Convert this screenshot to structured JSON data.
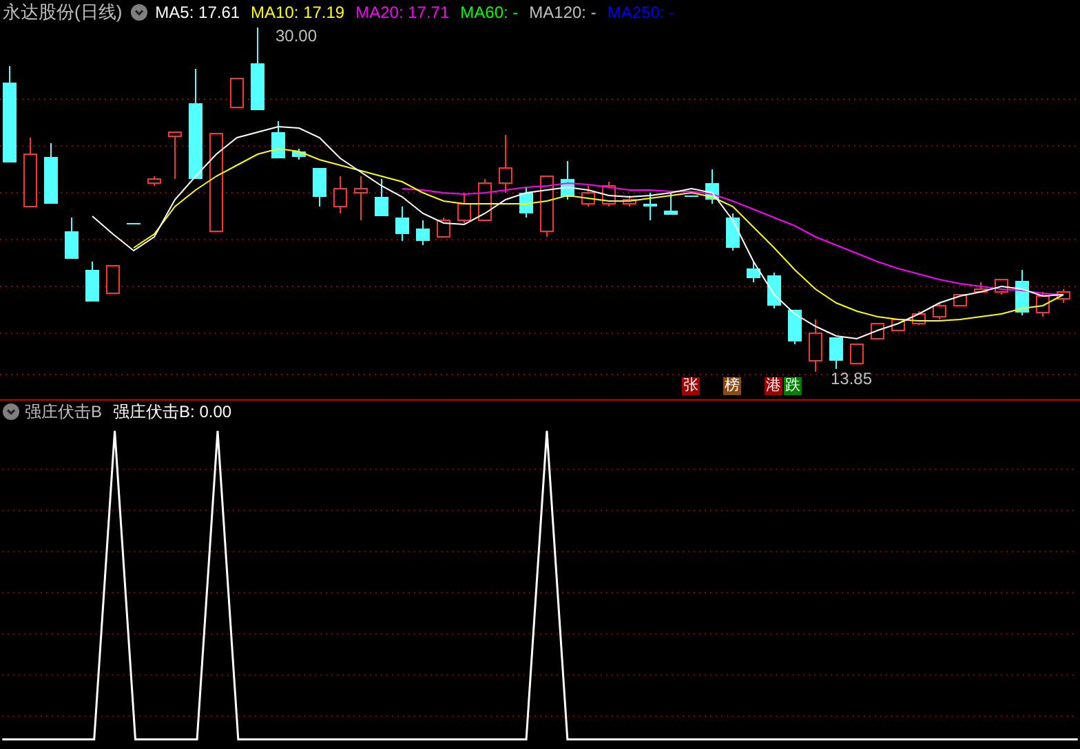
{
  "title": "永达股份(日线)",
  "ma_legend": [
    {
      "label": "MA5: 17.61",
      "color": "#ffffff"
    },
    {
      "label": "MA10: 17.19",
      "color": "#ffff00"
    },
    {
      "label": "MA20: 17.71",
      "color": "#ff00ff"
    },
    {
      "label": "MA60: -",
      "color": "#00ff00"
    },
    {
      "label": "MA120: -",
      "color": "#c0c0c0"
    },
    {
      "label": "MA250: -",
      "color": "#0000ff"
    }
  ],
  "high_label": "30.00",
  "low_label": "13.85",
  "tags": [
    {
      "text": "张",
      "color": "#a00000"
    },
    {
      "text": "榜",
      "color": "#8b4a10"
    },
    {
      "text": "港",
      "color": "#a00000"
    },
    {
      "text": "跌",
      "color": "#008000"
    }
  ],
  "indicator": {
    "name": "强庄伏击B",
    "value_label": "强庄伏击B: 0.00"
  }
}
